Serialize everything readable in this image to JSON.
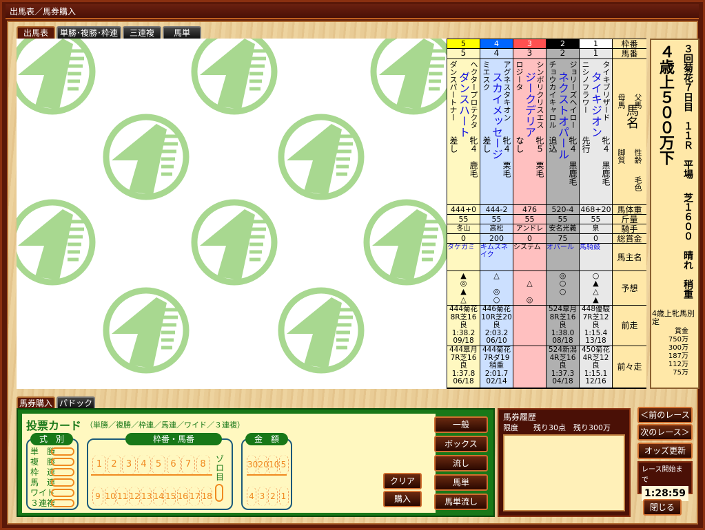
{
  "window": {
    "title": "出馬表／馬券購入"
  },
  "top_tabs": [
    "出馬表",
    "単勝･複勝･枠連",
    "三連複",
    "馬単"
  ],
  "row_labels": {
    "frame": "枠番",
    "number": "馬番",
    "sire": "父馬",
    "name": "馬名",
    "dam": "母馬",
    "sex_age": "性齢",
    "style": "脚質",
    "coat": "毛色",
    "weight": "馬体重",
    "kinryo": "斤量",
    "jockey": "騎手",
    "prize": "総賞金",
    "owner": "馬主名",
    "prediction": "予想",
    "prev1": "前走",
    "prev2": "前々走"
  },
  "horses": [
    {
      "frame": "5",
      "num": "5",
      "frame_color": "#ffff00",
      "frame_text": "#000",
      "bg": "#fff8c0",
      "sire": "ヘクタープロテクタ",
      "name": "ダンスハート",
      "dam": "ダンスパートナー",
      "sex_age": "牝４",
      "coat": "鹿毛",
      "style": "差し",
      "weight": "444+0",
      "kinryo": "55",
      "jockey": "冬山",
      "prize": "0",
      "owner": "タケガミ",
      "prediction": [
        "▲",
        "◎",
        "▲",
        "△"
      ],
      "prev1": [
        "444菊花",
        "8R芝16",
        "良",
        "1:38.2",
        "09/18"
      ],
      "prev2": [
        "444皐月",
        "7R芝16",
        "良",
        "1:37.8",
        "06/18"
      ]
    },
    {
      "frame": "4",
      "num": "4",
      "frame_color": "#0066ff",
      "frame_text": "#fff",
      "bg": "#cce0ff",
      "sire": "アグネスタキオン",
      "name": "スカイメッセージ",
      "dam": "ミエスク",
      "sex_age": "牝４",
      "coat": "栗毛",
      "style": "差し",
      "weight": "444-2",
      "kinryo": "55",
      "jockey": "高松",
      "prize": "200",
      "owner": "キムスネイク",
      "prediction": [
        "△",
        "",
        "◎",
        "○"
      ],
      "prev1": [
        "446菊花",
        "10R芝20",
        "良",
        "2:03.2",
        "06/10"
      ],
      "prev2": [
        "444菊花",
        "7Rダ19",
        "稍重",
        "2:01.7",
        "02/14"
      ]
    },
    {
      "frame": "3",
      "num": "3",
      "frame_color": "#ff5050",
      "frame_text": "#fff",
      "bg": "#ffc0c0",
      "sire": "シンボリクリスエス",
      "name": "ジークデリア",
      "dam": "ロジータ",
      "sex_age": "牝５",
      "coat": "栗毛",
      "style": "なし",
      "weight": "476",
      "kinryo": "55",
      "jockey": "アンドレ",
      "prize": "0",
      "owner": "システム",
      "prediction": [
        "",
        "△",
        "",
        "◎"
      ],
      "prev1": [
        "",
        "",
        "",
        "",
        ""
      ],
      "prev2": [
        "",
        "",
        "",
        "",
        ""
      ]
    },
    {
      "frame": "2",
      "num": "2",
      "frame_color": "#000000",
      "frame_text": "#fff",
      "bg": "#b0b0b0",
      "sire": "ジョリーズヘイロー",
      "name": "ネクストオパール",
      "dam": "チョウカイキャロル",
      "sex_age": "牝４",
      "coat": "黒鹿毛",
      "style": "追込",
      "weight": "520-4",
      "kinryo": "55",
      "jockey": "安名光義",
      "prize": "75",
      "owner": "オパール",
      "prediction": [
        "◎",
        "○",
        "○",
        ""
      ],
      "prev1": [
        "524皐月",
        "8R芝16",
        "良",
        "1:38.0",
        "08/18"
      ],
      "prev2": [
        "524新潟",
        "4R芝16",
        "良",
        "1:37.3",
        "04/18"
      ]
    },
    {
      "frame": "1",
      "num": "1",
      "frame_color": "#ffffff",
      "frame_text": "#000",
      "bg": "#e8e8e8",
      "sire": "タイキブリザード",
      "name": "タイキジオン",
      "dam": "ニシノフラワー",
      "sex_age": "牝４",
      "coat": "黒鹿毛",
      "style": "先行",
      "weight": "468+20",
      "kinryo": "55",
      "jockey": "泉",
      "prize": "0",
      "owner": "馬騎鼓",
      "prediction": [
        "○",
        "▲",
        "△",
        "▲"
      ],
      "prev1": [
        "448優駿",
        "7R芝12",
        "良",
        "1:15.4",
        "13/18"
      ],
      "prev2": [
        "450菊花",
        "4R芝12",
        "良",
        "1:15.1",
        "12/16"
      ]
    }
  ],
  "race": {
    "title": "４歳上５００万下",
    "meeting": "３回菊花７日目　１１Ｒ　平場",
    "course": "芝１６００　晴れ　稍重",
    "condition": "4歳上牝馬別定",
    "prize_label": "賞金",
    "prizes": [
      "750万",
      "300万",
      "187万",
      "112万",
      "75万"
    ]
  },
  "bottom_tabs": [
    "馬券購入",
    "パドック"
  ],
  "card": {
    "title": "投票カード",
    "subtitle": "（単勝／複勝／枠連／馬連／ワイド／３連複）",
    "type_header": "式　別",
    "types": [
      "単　勝",
      "複　勝",
      "枠　連",
      "馬　連",
      "ワイド",
      "３連複"
    ],
    "number_header": "枠番・馬番",
    "numbers_row1": [
      "1",
      "2",
      "3",
      "4",
      "5",
      "6",
      "7",
      "8"
    ],
    "numbers_row2": [
      "9",
      "10",
      "11",
      "12",
      "13",
      "14",
      "15",
      "16",
      "17",
      "18"
    ],
    "zorome": "ゾロ目",
    "amount_header": "金　額",
    "amounts_row1": [
      "30",
      "20",
      "10",
      "5"
    ],
    "amounts_row2": [
      "4",
      "3",
      "2",
      "1"
    ],
    "clear": "クリア",
    "buy": "購入"
  },
  "modes": [
    "一般",
    "ボックス",
    "流し",
    "馬単",
    "馬単流し"
  ],
  "history": {
    "title": "馬券履歴",
    "limit": "限度　　残り30点　残り300万"
  },
  "controls": {
    "prev_race": "＜前のレース",
    "next_race": "次のレース＞",
    "update_odds": "オッズ更新",
    "countdown_label": "レース開始まで",
    "countdown": "1:28:59",
    "close": "閉じる"
  }
}
